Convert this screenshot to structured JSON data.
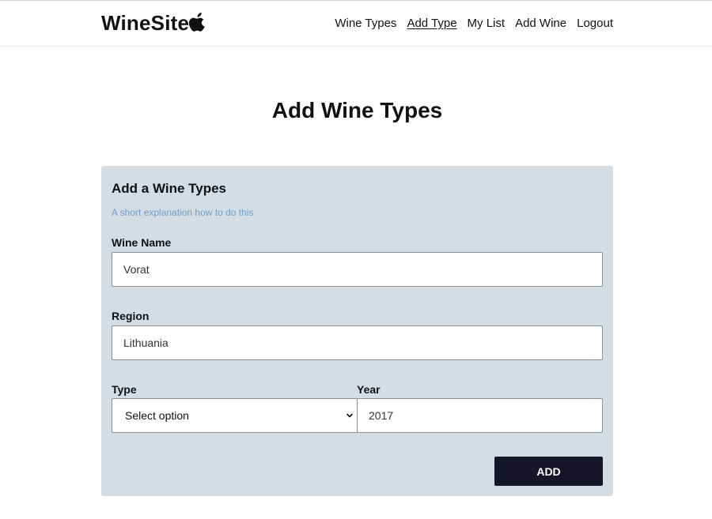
{
  "brand": {
    "name": "WineSite",
    "logo_icon": "apple-icon"
  },
  "nav": {
    "items": [
      {
        "label": "Wine Types"
      },
      {
        "label": "Add Type",
        "active": true
      },
      {
        "label": "My List"
      },
      {
        "label": "Add Wine"
      },
      {
        "label": "Logout"
      }
    ]
  },
  "page": {
    "title": "Add Wine Types"
  },
  "form": {
    "title": "Add a Wine Types",
    "hint": "A short explanation how to do this",
    "wine_name": {
      "label": "Wine Name",
      "value": "Vorat"
    },
    "region": {
      "label": "Region",
      "value": "Lithuania"
    },
    "type": {
      "label": "Type",
      "selected": "Select option"
    },
    "year": {
      "label": "Year",
      "value": "2017"
    },
    "submit_label": "ADD"
  },
  "colors": {
    "card_background": "#d5dde4",
    "hint_text": "#6f9dc8",
    "button_background": "#16152a"
  }
}
